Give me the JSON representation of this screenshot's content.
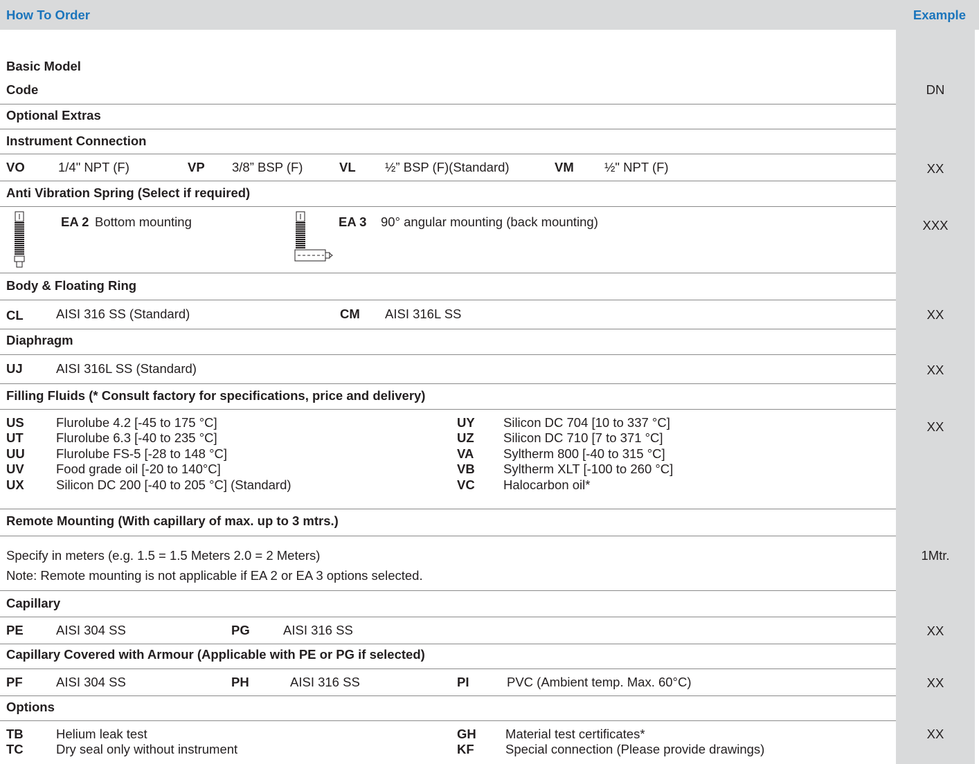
{
  "header": {
    "title": "How To Order",
    "example": "Example"
  },
  "sections": {
    "basic_model": "Basic Model",
    "code": "Code",
    "optional_extras": "Optional Extras",
    "instrument_connection": "Instrument Connection",
    "anti_vibration": "Anti Vibration Spring (Select if required)",
    "body_ring": "Body & Floating Ring",
    "diaphragm": "Diaphragm",
    "filling_fluids": "Filling Fluids (* Consult factory for specifications, price and delivery)",
    "remote_mounting": "Remote Mounting (With capillary of max. up to 3 mtrs.)",
    "capillary": "Capillary",
    "capillary_armour": "Capillary Covered with Armour (Applicable with PE or PG if selected)",
    "options": "Options"
  },
  "examples": {
    "code": "DN",
    "instrument": "XX",
    "spring": "XXX",
    "body": "XX",
    "diaphragm": "XX",
    "filling": "XX",
    "remote": "1Mtr.",
    "capillary": "XX",
    "armour": "XX",
    "options": "XX"
  },
  "instrument": [
    {
      "code": "VO",
      "desc": "1/4\" NPT (F)"
    },
    {
      "code": "VP",
      "desc": "3/8” BSP (F)"
    },
    {
      "code": "VL",
      "desc": "½” BSP (F)(Standard)"
    },
    {
      "code": "VM",
      "desc": "½\" NPT (F)"
    }
  ],
  "spring": [
    {
      "code": "EA 2",
      "desc": "Bottom mounting",
      "icon": "spring-bottom-icon"
    },
    {
      "code": "EA 3",
      "desc": "90° angular mounting (back mounting)",
      "icon": "spring-angular-icon"
    }
  ],
  "body": [
    {
      "code": "CL",
      "desc": "AISI 316 SS (Standard)"
    },
    {
      "code": "CM",
      "desc": "AISI 316L SS"
    }
  ],
  "diaphragm": [
    {
      "code": "UJ",
      "desc": "AISI 316L SS (Standard)"
    }
  ],
  "filling_left": [
    {
      "code": "US",
      "desc": "Flurolube 4.2 [-45 to 175 °C]"
    },
    {
      "code": "UT",
      "desc": "Flurolube 6.3 [-40 to 235 °C]"
    },
    {
      "code": "UU",
      "desc": "Flurolube FS-5 [-28 to 148 °C]"
    },
    {
      "code": "UV",
      "desc": "Food grade  oil [-20 to 140°C]"
    },
    {
      "code": "UX",
      "desc": "Silicon DC 200 [-40 to 205 °C] (Standard)"
    }
  ],
  "filling_right": [
    {
      "code": "UY",
      "desc": "Silicon DC 704 [10 to 337 °C]"
    },
    {
      "code": "UZ",
      "desc": "Silicon DC 710 [7 to 371 °C]"
    },
    {
      "code": "VA",
      "desc": "Syltherm 800 [-40 to 315 °C]"
    },
    {
      "code": "VB",
      "desc": "Syltherm XLT [-100 to 260 °C]"
    },
    {
      "code": "VC",
      "desc": "Halocarbon oil*"
    }
  ],
  "remote": {
    "line1": "Specify in meters  (e.g. 1.5 = 1.5 Meters  2.0 = 2 Meters)",
    "line2": "Note: Remote mounting is not applicable if EA 2 or EA 3 options selected."
  },
  "capillary": [
    {
      "code": "PE",
      "desc": "AISI  304 SS"
    },
    {
      "code": "PG",
      "desc": "AISI  316 SS"
    }
  ],
  "armour": [
    {
      "code": "PF",
      "desc": "AISI  304 SS"
    },
    {
      "code": "PH",
      "desc": "AISI  316 SS"
    },
    {
      "code": "PI",
      "desc": "PVC (Ambient temp. Max. 60°C)"
    }
  ],
  "options": [
    {
      "code": "TB",
      "desc": "Helium leak test"
    },
    {
      "code": "TC",
      "desc": "Dry seal only without instrument"
    },
    {
      "code": "GH",
      "desc": "Material test certificates*"
    },
    {
      "code": "KF",
      "desc": "Special connection (Please provide drawings)"
    }
  ],
  "colors": {
    "accent": "#1b75bc",
    "band": "#d9dadb",
    "text": "#231f20"
  }
}
